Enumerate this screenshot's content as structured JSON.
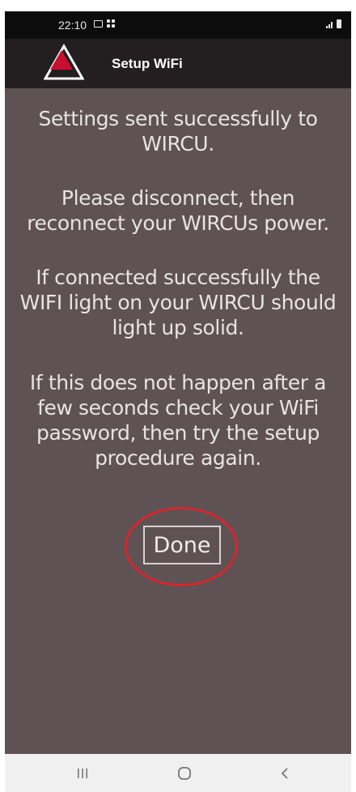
{
  "status_bar": {
    "time": "22:10"
  },
  "app_bar": {
    "title": "Setup WiFi"
  },
  "messages": {
    "success": "Settings sent successfully to WIRCU.",
    "disconnect": "Please disconnect, then reconnect your WIRCUs power.",
    "wifi_light": "If connected successfully the WIFI light on your WIRCU should light up solid.",
    "troubleshoot": "If this does not happen after a few seconds check your WiFi password, then try the setup procedure again."
  },
  "actions": {
    "done_label": "Done"
  },
  "icons": {
    "logo": "red-triangle-logo-icon",
    "recent_apps": "recent-apps-icon",
    "home": "home-icon",
    "back": "back-icon"
  },
  "colors": {
    "background": "#5e5255",
    "app_bar": "#231f20",
    "highlight_ring": "#d8262c",
    "logo_red": "#c8102e"
  }
}
